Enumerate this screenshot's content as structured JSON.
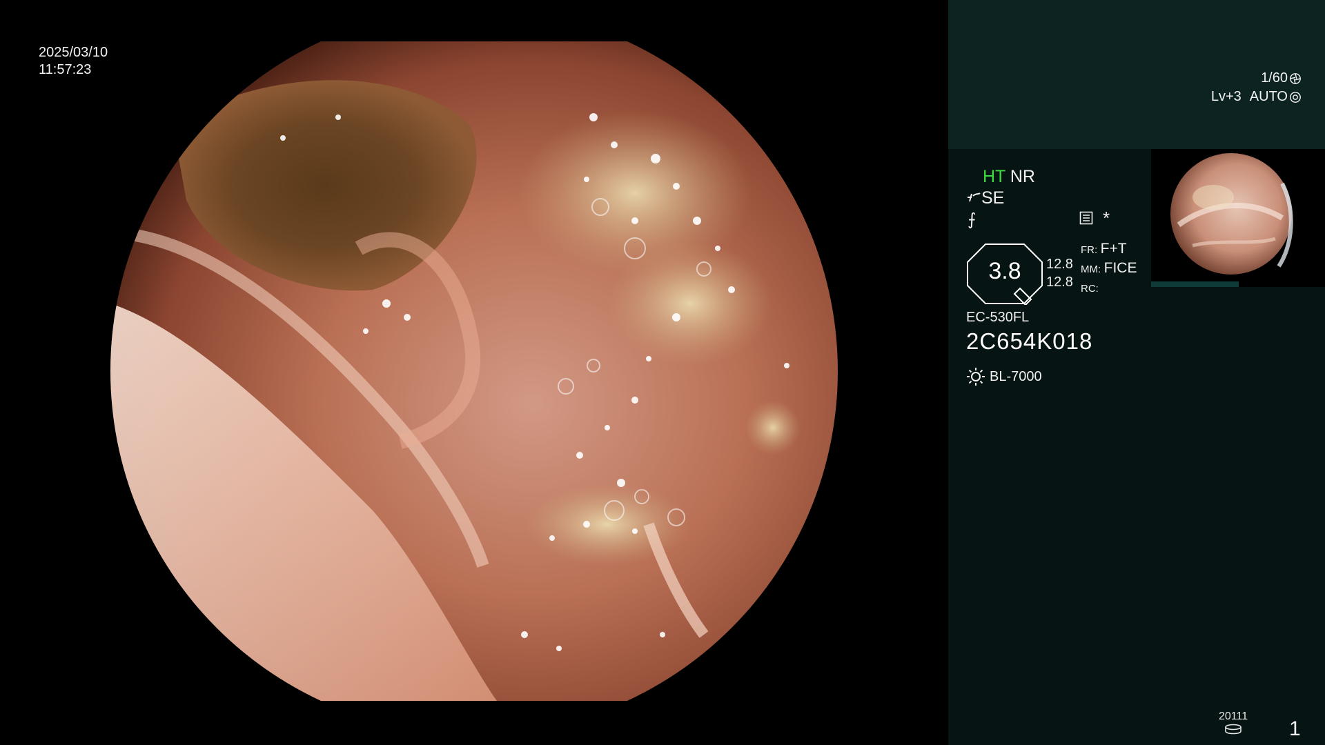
{
  "overlay": {
    "date": "2025/03/10",
    "time": "11:57:23",
    "shutter": "1/60",
    "level": "Lv+3",
    "iris_mode": "AUTO"
  },
  "status": {
    "ht_label": "HT",
    "nr_label": "NR",
    "se_label": "SE",
    "f_glyph": "⨍",
    "star_glyph": "*",
    "gauge_value": "3.8",
    "readout_1": "12.8",
    "readout_2": "12.8",
    "fr_label": "FR:",
    "fr_value": "F+T",
    "mm_label": "MM:",
    "mm_value": "FICE",
    "rc_label": "RC:",
    "rc_value": ""
  },
  "scope": {
    "model": "EC-530FL",
    "serial": "2C654K018",
    "light_source": "BL-7000"
  },
  "footer": {
    "storage_code": "20111",
    "page_number": "1"
  },
  "icons": {
    "shutter_icon": "aperture-icon",
    "auto_icon": "iris-icon",
    "se_icon": "structure-enhancement-icon",
    "mode_icon": "menu-icon",
    "light_icon": "sun-icon",
    "storage_icon": "storage-disk-icon"
  },
  "colors": {
    "ht_accent": "#3fdc3f",
    "panel_bg": "#061413",
    "panel_top": "#0c2322"
  }
}
